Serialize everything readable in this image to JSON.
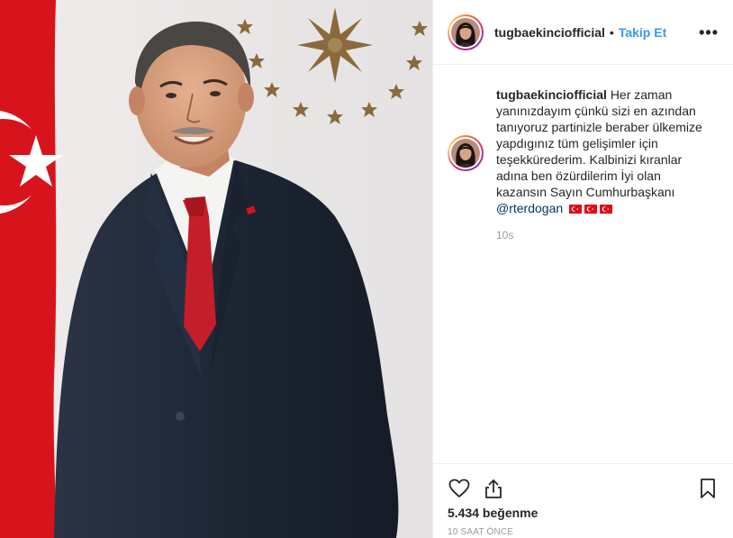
{
  "post": {
    "photo_icon": "portrait-photo",
    "colors": {
      "flag_red": "#e30a17",
      "suit": "#1e2733",
      "tie": "#c41e2a",
      "star_gold": "#8a6a3c"
    }
  },
  "header": {
    "username": "tugbaekinciofficial",
    "separator": "•",
    "follow_label": "Takip Et",
    "more_label": "•••"
  },
  "comment": {
    "username": "tugbaekinciofficial",
    "text": "Her zaman yanınızdayım çünkü sizi en azından tanıyoruz partinizle beraber ülkemize yapdıgınız tüm gelişimler için teşekkürederim. Kalbinizi kıranlar adına ben özürdilerim İyi olan kazansın Sayın Cumhurbaşkanı",
    "mention": "@rterdogan",
    "flags": [
      "turkey-flag-emoji",
      "turkey-flag-emoji",
      "turkey-flag-emoji"
    ],
    "time": "10s"
  },
  "actions": {
    "like_icon": "heart-icon",
    "share_icon": "share-icon",
    "save_icon": "bookmark-icon",
    "likes_text": "5.434 beğenme",
    "posted_ago": "10 SAAT ÖNCE"
  },
  "colors": {
    "link_blue": "#3897f0",
    "mention_blue": "#003569",
    "muted": "#999999",
    "text": "#262626",
    "border": "#efefef"
  }
}
